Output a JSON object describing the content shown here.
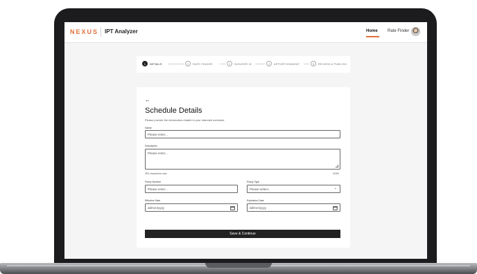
{
  "app": {
    "logo": "NEXUS",
    "name": "IPT Analyzer"
  },
  "nav": {
    "home": "Home",
    "rate_finder": "Rate Finder"
  },
  "stepper": [
    {
      "num": "1",
      "label": "DETAILS"
    },
    {
      "num": "2",
      "label": "RATE FINDER"
    },
    {
      "num": "3",
      "label": "INSURER ID"
    },
    {
      "num": "4",
      "label": "APPORTIONMENT"
    },
    {
      "num": "5",
      "label": "REVIEW & PUBLISH"
    }
  ],
  "form": {
    "back_icon": "←",
    "title": "Schedule Details",
    "subtitle": "Please provide the information related to your intended schedule.",
    "name_label": "Name",
    "name_placeholder": "Please enter...",
    "description_label": "Description",
    "description_placeholder": "Please enter...",
    "chars_max": "300 characters max",
    "char_count": "0/300",
    "policy_number_label": "Policy Number",
    "policy_number_placeholder": "Please enter...",
    "policy_type_label": "Policy Type",
    "policy_type_placeholder": "Please select...",
    "effective_label": "Effective Date",
    "effective_placeholder": "dd/mm/yyyy",
    "expiration_label": "Expiration Date",
    "expiration_placeholder": "dd/mm/yyyy",
    "save_label": "Save & Continue"
  },
  "colors": {
    "accent": "#e0703a",
    "primary_button": "#222222"
  }
}
